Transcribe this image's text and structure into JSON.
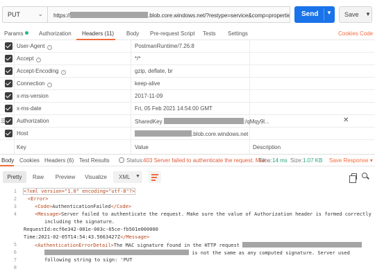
{
  "request": {
    "method": "PUT",
    "url_prefix": "https://",
    "url_suffix": ".blob.core.windows.net/?restype=service&comp=properties",
    "send_label": "Send",
    "save_label": "Save"
  },
  "req_tabs": {
    "params": "Params",
    "authorization": "Authorization",
    "headers": "Headers (11)",
    "body": "Body",
    "prerequest": "Pre-request Script",
    "tests": "Tests",
    "settings": "Settings",
    "cookies": "Cookies",
    "code": "Code"
  },
  "headers": [
    {
      "key": "User-Agent",
      "value": "PostmanRuntime/7.26.8"
    },
    {
      "key": "Accept",
      "value": "*/*"
    },
    {
      "key": "Accept-Encoding",
      "value": "gzip, deflate, br"
    },
    {
      "key": "Connection",
      "value": "keep-alive"
    },
    {
      "key": "x-ms-version",
      "value": "2017-11-09"
    },
    {
      "key": "x-ms-date",
      "value": "Fri, 05 Feb 2021 14:54:00 GMT"
    },
    {
      "key": "Authorization",
      "value_prefix": "SharedKey ",
      "value_suffix": ":/qMqy9l..."
    },
    {
      "key": "Host",
      "value_suffix": ".blob.core.windows.net"
    }
  ],
  "placeholders": {
    "key": "Key",
    "value": "Value",
    "description": "Description"
  },
  "response_tabs": {
    "body": "Body",
    "cookies": "Cookies",
    "headers": "Headers (6)",
    "test_results": "Test Results",
    "status_label": "Status:",
    "status_value": "403 Server failed to authenticate the request. Mak...",
    "time_label": "Time:",
    "time_value": "14 ms",
    "size_label": "Size:",
    "size_value": "1.07 KB",
    "save_response": "Save Response"
  },
  "view_bar": {
    "pretty": "Pretty",
    "raw": "Raw",
    "preview": "Preview",
    "visualize": "Visualize",
    "format": "XML"
  },
  "code": {
    "line_numbers": [
      "1",
      "2",
      "3",
      "4",
      "5",
      "6",
      "7",
      "8"
    ],
    "l1_decl": "<?xml version=\"1.0\" encoding=\"utf-8\"?>",
    "l2": "<Error>",
    "l3_open": "<Code>",
    "l3_text": "AuthenticationFailed",
    "l3_close": "</Code>",
    "l4_open": "<Message>",
    "l4_text": "Server failed to authenticate the request. Make sure the value of Authorization header is formed correctly",
    "l4_text2": "including the signature.",
    "l4_text3": "RequestId:ecf6e342-001e-003c-65ce-fb501e000000",
    "l4_text4": "Time:2021-02-05T14:54:43.5663427Z",
    "l4_close": "</Message>",
    "l5_open": "<AuthenticationErrorDetail>",
    "l5_text": "The MAC signature found in the HTTP request",
    "l5_text2": "is not the same as any computed signature. Server used",
    "l5_text3": "following string to sign: 'PUT"
  },
  "colors": {
    "send": "#1a73e8",
    "accent": "#f26b3a",
    "status_error": "#e15a3c",
    "success": "#26b47f"
  }
}
